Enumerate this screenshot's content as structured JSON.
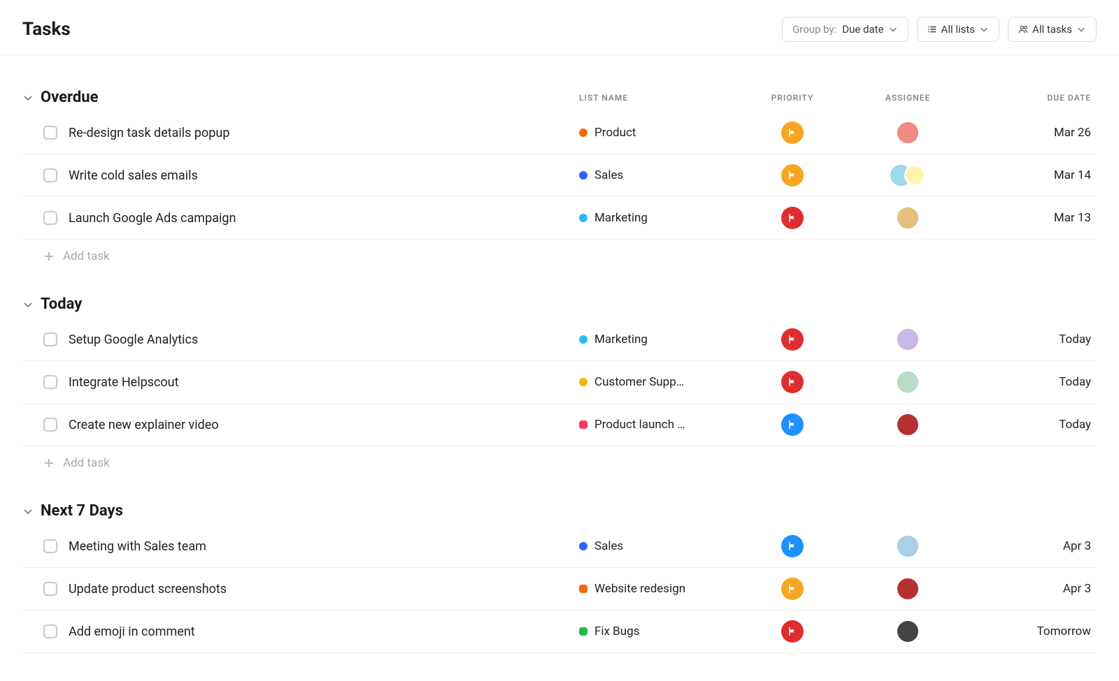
{
  "page_title": "Tasks",
  "toolbar": {
    "group_by_label": "Group by:",
    "group_by_value": "Due date",
    "lists_label": "All lists",
    "tasks_label": "All tasks"
  },
  "columns": {
    "list": "LIST NAME",
    "priority": "PRIORITY",
    "assignee": "ASSIGNEE",
    "due": "DUE DATE"
  },
  "add_task_label": "Add task",
  "priority_colors": {
    "high": "#e02d2d",
    "medium": "#f5a623",
    "low": "#1e90ff"
  },
  "list_colors": {
    "product": "#f56a00",
    "sales": "#2962ff",
    "marketing": "#2dbaf0",
    "customer_support": "#f5b400",
    "product_launch": "#ff3366",
    "website_redesign": "#f56a00",
    "fix_bugs": "#1db954"
  },
  "avatar_colors": {
    "a1": "#f28b82",
    "a2": "#a0d8ef",
    "a3": "#fff3b0",
    "a4": "#e8c07d",
    "a5": "#c9b8e8",
    "a6": "#b8dcc8",
    "a7": "#a8d0e6",
    "a8": "#b73030",
    "a9": "#444444"
  },
  "groups": [
    {
      "title": "Overdue",
      "show_add": true,
      "tasks": [
        {
          "title": "Re-design task details popup",
          "list": "Product",
          "list_color": "product",
          "list_shape": "dot",
          "priority": "medium",
          "assignees": [
            "a1"
          ],
          "due": "Mar 26"
        },
        {
          "title": "Write cold sales emails",
          "list": "Sales",
          "list_color": "sales",
          "list_shape": "dot",
          "priority": "medium",
          "assignees": [
            "a2",
            "a3"
          ],
          "due": "Mar 14"
        },
        {
          "title": "Launch Google Ads campaign",
          "list": "Marketing",
          "list_color": "marketing",
          "list_shape": "dot",
          "priority": "high",
          "assignees": [
            "a4"
          ],
          "due": "Mar 13"
        }
      ]
    },
    {
      "title": "Today",
      "show_add": true,
      "tasks": [
        {
          "title": "Setup Google Analytics",
          "list": "Marketing",
          "list_color": "marketing",
          "list_shape": "dot",
          "priority": "high",
          "assignees": [
            "a5"
          ],
          "due": "Today"
        },
        {
          "title": "Integrate Helpscout",
          "list": "Customer Supp…",
          "list_color": "customer_support",
          "list_shape": "dot",
          "priority": "high",
          "assignees": [
            "a6"
          ],
          "due": "Today"
        },
        {
          "title": "Create new explainer video",
          "list": "Product launch …",
          "list_color": "product_launch",
          "list_shape": "rdot",
          "priority": "low",
          "assignees": [
            "a8"
          ],
          "due": "Today"
        }
      ]
    },
    {
      "title": "Next 7 Days",
      "show_add": false,
      "tasks": [
        {
          "title": "Meeting with Sales team",
          "list": "Sales",
          "list_color": "sales",
          "list_shape": "dot",
          "priority": "low",
          "assignees": [
            "a7"
          ],
          "due": "Apr 3"
        },
        {
          "title": "Update product screenshots",
          "list": "Website redesign",
          "list_color": "website_redesign",
          "list_shape": "rdot",
          "priority": "medium",
          "assignees": [
            "a8"
          ],
          "due": "Apr 3"
        },
        {
          "title": "Add emoji in comment",
          "list": "Fix Bugs",
          "list_color": "fix_bugs",
          "list_shape": "rdot",
          "priority": "high",
          "assignees": [
            "a9"
          ],
          "due": "Tomorrow"
        }
      ]
    }
  ]
}
